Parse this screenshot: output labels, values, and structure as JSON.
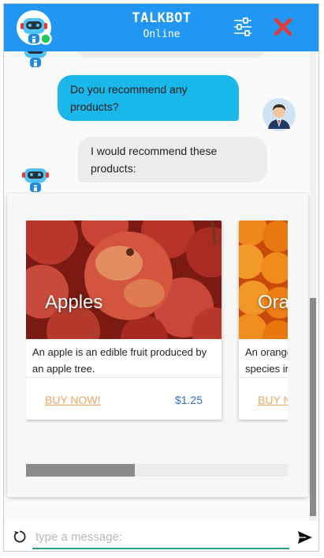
{
  "header": {
    "title": "TALKBOT",
    "status": "Online",
    "icons": {
      "avatar": "robot-avatar-icon",
      "settings": "sliders-icon",
      "close": "close-icon"
    },
    "colors": {
      "header_bg": "#2196f3",
      "online_dot": "#22c55e",
      "close": "#e53935"
    }
  },
  "messages": [
    {
      "sender": "user",
      "text": "Do you recommend any products?"
    },
    {
      "sender": "bot",
      "text": "I would recommend these products:"
    }
  ],
  "carousel": {
    "products": [
      {
        "name": "Apples",
        "description": "An apple is an edible fruit produced by an apple tree.",
        "buy_label": "BUY NOW!",
        "price": "$1.25"
      },
      {
        "name": "Oranges",
        "description": "An orange is the fruit of the citrus species in the family Rutaceae.",
        "buy_label": "BUY NOW!",
        "price": ""
      }
    ]
  },
  "composer": {
    "placeholder": "type a message:",
    "icons": {
      "reset": "refresh-icon",
      "send": "send-icon"
    }
  }
}
